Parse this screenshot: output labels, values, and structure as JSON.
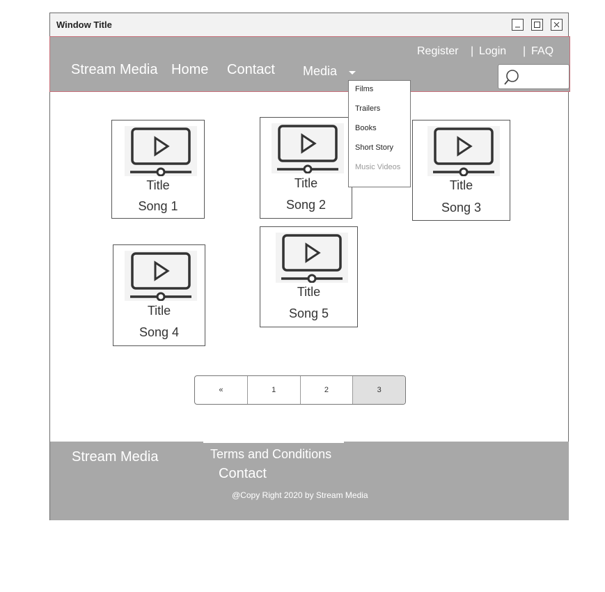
{
  "window": {
    "title": "Window Title"
  },
  "nav": {
    "brand": "Stream Media",
    "home": "Home",
    "contact": "Contact",
    "media": "Media",
    "top_links": {
      "register": "Register",
      "login": "Login",
      "faq": "FAQ",
      "separator": "|"
    }
  },
  "media_menu": {
    "items": [
      "Films",
      "Trailers",
      "Books",
      "Short Story",
      "Music Videos"
    ],
    "disabled_index": 4
  },
  "cards": [
    {
      "title": "Title",
      "song": "Song 1",
      "icon": "video-player-icon"
    },
    {
      "title": "Title",
      "song": "Song 2",
      "icon": "video-player-icon"
    },
    {
      "title": "Title",
      "song": "Song 3",
      "icon": "video-player-icon"
    },
    {
      "title": "Title",
      "song": "Song 4",
      "icon": "video-player-icon"
    },
    {
      "title": "Title",
      "song": "Song 5",
      "icon": "video-player-icon"
    }
  ],
  "pagination": {
    "prev": "«",
    "pages": [
      "1",
      "2",
      "3"
    ],
    "current": "3"
  },
  "footer": {
    "brand": "Stream Media",
    "terms": "Terms and Conditions",
    "contact": "Contact",
    "copyright": "@Copy Right 2020 by Stream Media"
  },
  "colors": {
    "nav_bg": "#a8a8a8",
    "nav_border": "#c9707a",
    "footer_bg": "#a8a8a8",
    "text_light": "#ffffff"
  }
}
